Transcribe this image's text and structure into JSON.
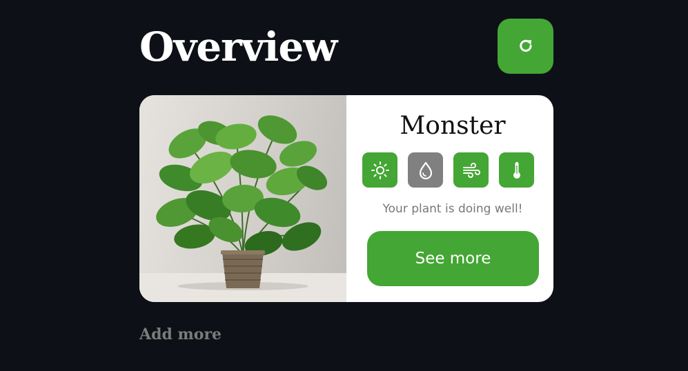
{
  "header": {
    "title": "Overview"
  },
  "refresh_button": {
    "icon": "refresh-icon"
  },
  "plant_card": {
    "name": "Monster",
    "image": "monstera-plant-photo",
    "status_icons": [
      {
        "icon": "sun-icon",
        "label": "light",
        "state": "ok",
        "color": "#44a634"
      },
      {
        "icon": "water-drop-icon",
        "label": "water",
        "state": "inactive",
        "color": "#808080"
      },
      {
        "icon": "wind-icon",
        "label": "air",
        "state": "ok",
        "color": "#44a634"
      },
      {
        "icon": "thermometer-icon",
        "label": "temperature",
        "state": "ok",
        "color": "#44a634"
      }
    ],
    "status_text": "Your plant is doing well!",
    "see_more_label": "See more"
  },
  "add_more_label": "Add more",
  "colors": {
    "background": "#0d1017",
    "accent": "#44a634",
    "inactive": "#808080",
    "card": "#ffffff"
  }
}
